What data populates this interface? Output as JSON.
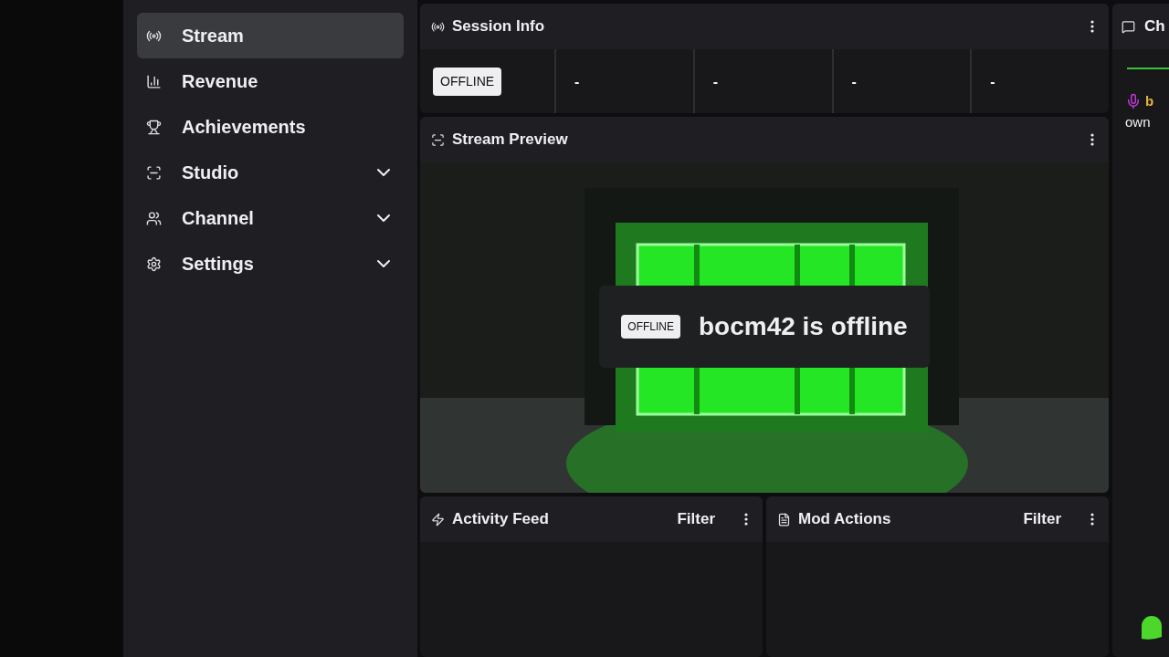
{
  "sidebar": {
    "items": [
      {
        "label": "Stream",
        "kind": "link",
        "selected": true
      },
      {
        "label": "Revenue",
        "kind": "link",
        "selected": false
      },
      {
        "label": "Achievements",
        "kind": "link",
        "selected": false
      },
      {
        "label": "Studio",
        "kind": "group",
        "expanded": false,
        "selected": false
      },
      {
        "label": "Channel",
        "kind": "group",
        "expanded": false,
        "selected": false
      },
      {
        "label": "Settings",
        "kind": "group",
        "expanded": false,
        "selected": false
      }
    ]
  },
  "session_info": {
    "title": "Session Info",
    "status": "OFFLINE",
    "stats": [
      {
        "value": "-"
      },
      {
        "value": "-"
      },
      {
        "value": "-"
      },
      {
        "value": "-"
      }
    ]
  },
  "stream_preview": {
    "title": "Stream Preview",
    "badge": "OFFLINE",
    "message": "bocm42 is offline"
  },
  "activity_feed": {
    "title": "Activity Feed",
    "filter": "Filter"
  },
  "mod_actions": {
    "title": "Mod Actions",
    "filter": "Filter"
  },
  "chat": {
    "title": "Ch",
    "messages": [
      {
        "user": "b",
        "text": "own"
      }
    ]
  }
}
